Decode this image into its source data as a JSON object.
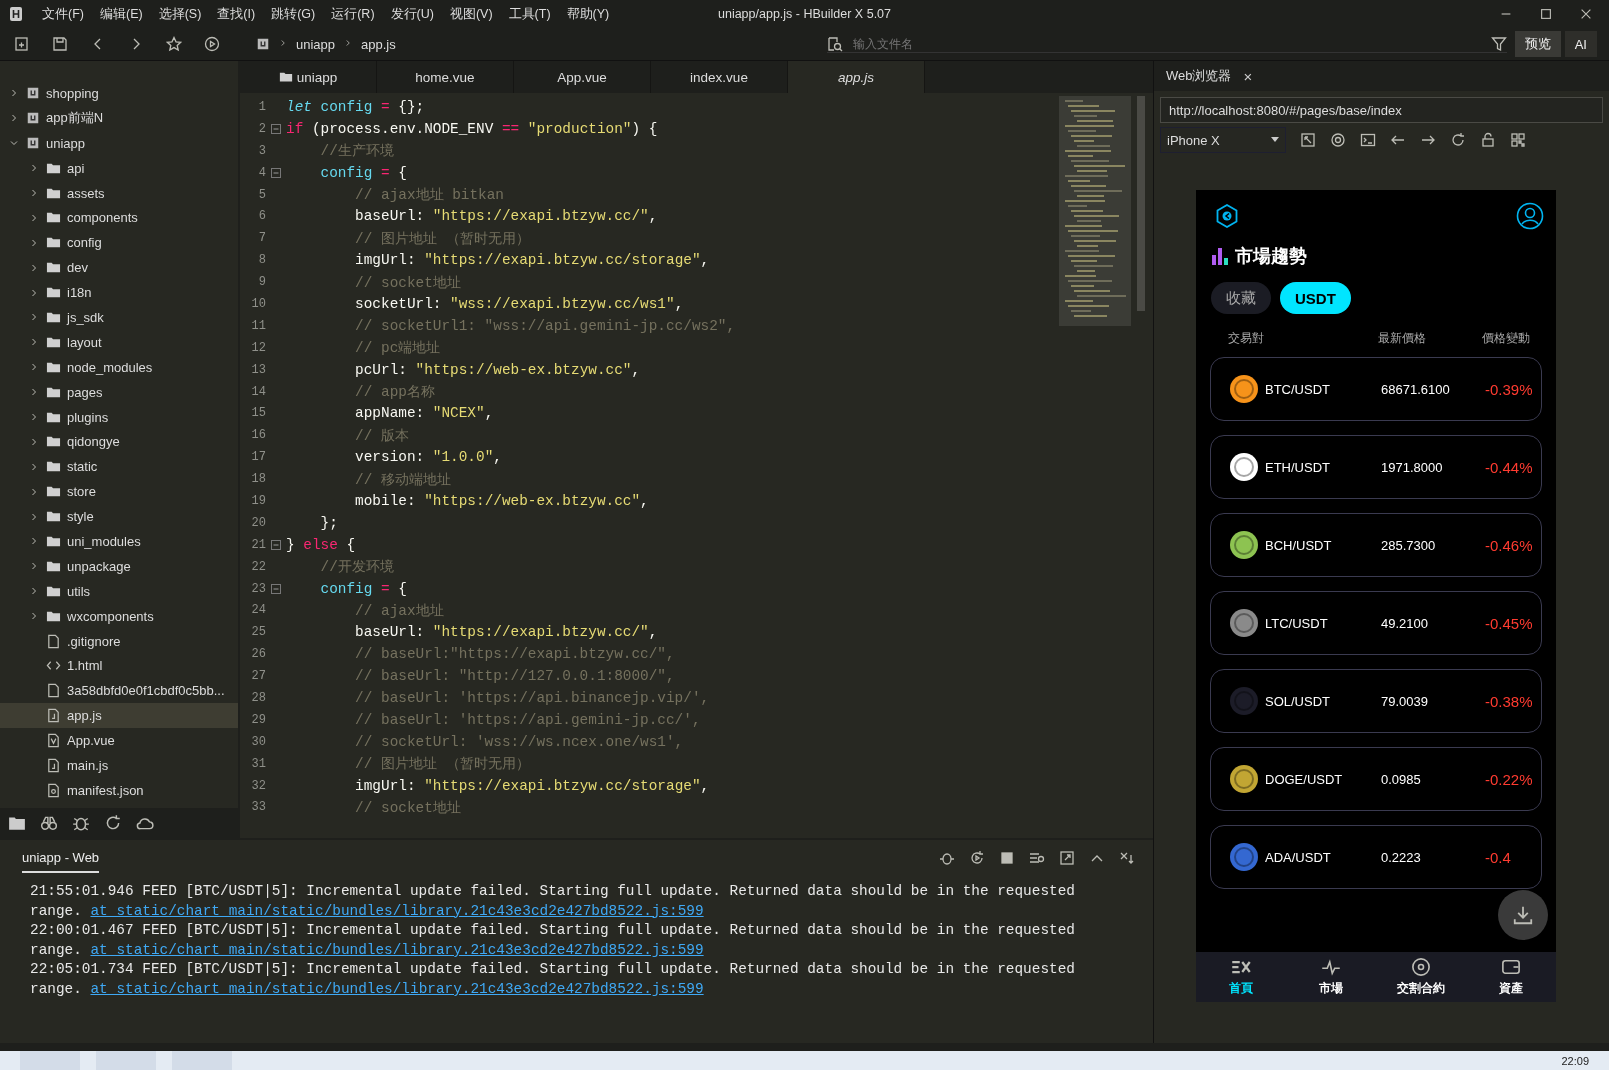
{
  "window": {
    "title": "uniapp/app.js - HBuilder X 5.07"
  },
  "menu": [
    "文件(F)",
    "编辑(E)",
    "选择(S)",
    "查找(I)",
    "跳转(G)",
    "运行(R)",
    "发行(U)",
    "视图(V)",
    "工具(T)",
    "帮助(Y)"
  ],
  "toolbar": {
    "breadcrumb": [
      "uniapp",
      "app.js"
    ],
    "search": {
      "placeholder": "输入文件名"
    },
    "buttons": [
      "预览",
      "AI"
    ]
  },
  "sidebar": {
    "tree": [
      {
        "name": "shopping",
        "kind": "project",
        "expanded": false,
        "selected": false
      },
      {
        "name": "app前端N",
        "kind": "project",
        "expanded": false,
        "selected": false
      },
      {
        "name": "uniapp",
        "kind": "project",
        "expanded": true,
        "selected": false,
        "children": [
          {
            "name": "api",
            "kind": "folder",
            "expanded": false,
            "selected": false
          },
          {
            "name": "assets",
            "kind": "folder",
            "expanded": false,
            "selected": false
          },
          {
            "name": "components",
            "kind": "folder",
            "expanded": false,
            "selected": false
          },
          {
            "name": "config",
            "kind": "folder",
            "expanded": false,
            "selected": false
          },
          {
            "name": "dev",
            "kind": "folder",
            "expanded": false,
            "selected": false
          },
          {
            "name": "i18n",
            "kind": "folder",
            "expanded": false,
            "selected": false
          },
          {
            "name": "js_sdk",
            "kind": "folder",
            "expanded": false,
            "selected": false
          },
          {
            "name": "layout",
            "kind": "folder",
            "expanded": false,
            "selected": false
          },
          {
            "name": "node_modules",
            "kind": "folder",
            "expanded": false,
            "selected": false
          },
          {
            "name": "pages",
            "kind": "folder",
            "expanded": false,
            "selected": false
          },
          {
            "name": "plugins",
            "kind": "folder",
            "expanded": false,
            "selected": false
          },
          {
            "name": "qidongye",
            "kind": "folder",
            "expanded": false,
            "selected": false
          },
          {
            "name": "static",
            "kind": "folder",
            "expanded": false,
            "selected": false
          },
          {
            "name": "store",
            "kind": "folder",
            "expanded": false,
            "selected": false
          },
          {
            "name": "style",
            "kind": "folder",
            "expanded": false,
            "selected": false
          },
          {
            "name": "uni_modules",
            "kind": "folder",
            "expanded": false,
            "selected": false
          },
          {
            "name": "unpackage",
            "kind": "folder",
            "expanded": false,
            "selected": false
          },
          {
            "name": "utils",
            "kind": "folder",
            "expanded": false,
            "selected": false
          },
          {
            "name": "wxcomponents",
            "kind": "folder",
            "expanded": false,
            "selected": false
          },
          {
            "name": ".gitignore",
            "kind": "file",
            "selected": false
          },
          {
            "name": "1.html",
            "kind": "html",
            "selected": false
          },
          {
            "name": "3a58dbfd0e0f1cbdf0c5bb...",
            "kind": "file",
            "selected": false
          },
          {
            "name": "app.js",
            "kind": "script",
            "selected": true
          },
          {
            "name": "App.vue",
            "kind": "vue",
            "selected": false
          },
          {
            "name": "main.js",
            "kind": "script",
            "selected": false
          },
          {
            "name": "manifest.json",
            "kind": "json",
            "selected": false
          }
        ]
      }
    ]
  },
  "editor": {
    "tabs": [
      {
        "label": "uniapp",
        "kind": "folder",
        "selected": false
      },
      {
        "label": "home.vue",
        "kind": "file",
        "selected": false
      },
      {
        "label": "App.vue",
        "kind": "file",
        "selected": false
      },
      {
        "label": "index.vue",
        "kind": "file",
        "selected": false
      },
      {
        "label": "app.js",
        "kind": "file",
        "selected": true
      }
    ],
    "lines": [
      {
        "number": "1",
        "fold": false,
        "tokens": [
          {
            "kind": "storage",
            "text": "let"
          },
          {
            "kind": "var",
            "text": " config"
          },
          {
            "kind": "op",
            "text": " ="
          },
          {
            "kind": "plain",
            "text": " {};"
          }
        ]
      },
      {
        "number": "2",
        "fold": true,
        "tokens": [
          {
            "kind": "kw",
            "text": "if"
          },
          {
            "kind": "plain",
            "text": " (process.env.NODE_ENV "
          },
          {
            "kind": "op",
            "text": "=="
          },
          {
            "kind": "str",
            "text": " \"production\""
          },
          {
            "kind": "plain",
            "text": ") {"
          }
        ]
      },
      {
        "number": "3",
        "fold": false,
        "tokens": [
          {
            "kind": "comment",
            "text": "    //生产环境"
          }
        ]
      },
      {
        "number": "4",
        "fold": true,
        "tokens": [
          {
            "kind": "var",
            "text": "    config"
          },
          {
            "kind": "op",
            "text": " ="
          },
          {
            "kind": "plain",
            "text": " {"
          }
        ]
      },
      {
        "number": "5",
        "fold": false,
        "tokens": [
          {
            "kind": "comment",
            "text": "        // ajax地址 bitkan"
          }
        ]
      },
      {
        "number": "6",
        "fold": false,
        "tokens": [
          {
            "kind": "plain",
            "text": "        baseUrl: "
          },
          {
            "kind": "str",
            "text": "\"https://exapi.btzyw.cc/\""
          },
          {
            "kind": "plain",
            "text": ","
          }
        ]
      },
      {
        "number": "7",
        "fold": false,
        "tokens": [
          {
            "kind": "comment",
            "text": "        // 图片地址 （暂时无用）"
          }
        ]
      },
      {
        "number": "8",
        "fold": false,
        "tokens": [
          {
            "kind": "plain",
            "text": "        imgUrl: "
          },
          {
            "kind": "str",
            "text": "\"https://exapi.btzyw.cc/storage\""
          },
          {
            "kind": "plain",
            "text": ","
          }
        ]
      },
      {
        "number": "9",
        "fold": false,
        "tokens": [
          {
            "kind": "comment",
            "text": "        // socket地址"
          }
        ]
      },
      {
        "number": "10",
        "fold": false,
        "tokens": [
          {
            "kind": "plain",
            "text": "        socketUrl: "
          },
          {
            "kind": "str",
            "text": "\"wss://exapi.btzyw.cc/ws1\""
          },
          {
            "kind": "plain",
            "text": ","
          }
        ]
      },
      {
        "number": "11",
        "fold": false,
        "tokens": [
          {
            "kind": "comment",
            "text": "        // socketUrl1: \"wss://api.gemini-jp.cc/ws2\","
          }
        ]
      },
      {
        "number": "12",
        "fold": false,
        "tokens": [
          {
            "kind": "comment",
            "text": "        // pc端地址"
          }
        ]
      },
      {
        "number": "13",
        "fold": false,
        "tokens": [
          {
            "kind": "plain",
            "text": "        pcUrl: "
          },
          {
            "kind": "str",
            "text": "\"https://web-ex.btzyw.cc\""
          },
          {
            "kind": "plain",
            "text": ","
          }
        ]
      },
      {
        "number": "14",
        "fold": false,
        "tokens": [
          {
            "kind": "comment",
            "text": "        // app名称"
          }
        ]
      },
      {
        "number": "15",
        "fold": false,
        "tokens": [
          {
            "kind": "plain",
            "text": "        appName: "
          },
          {
            "kind": "str",
            "text": "\"NCEX\""
          },
          {
            "kind": "plain",
            "text": ","
          }
        ]
      },
      {
        "number": "16",
        "fold": false,
        "tokens": [
          {
            "kind": "comment",
            "text": "        // 版本"
          }
        ]
      },
      {
        "number": "17",
        "fold": false,
        "tokens": [
          {
            "kind": "plain",
            "text": "        version: "
          },
          {
            "kind": "str",
            "text": "\"1.0.0\""
          },
          {
            "kind": "plain",
            "text": ","
          }
        ]
      },
      {
        "number": "18",
        "fold": false,
        "tokens": [
          {
            "kind": "comment",
            "text": "        // 移动端地址"
          }
        ]
      },
      {
        "number": "19",
        "fold": false,
        "tokens": [
          {
            "kind": "plain",
            "text": "        mobile: "
          },
          {
            "kind": "str",
            "text": "\"https://web-ex.btzyw.cc\""
          },
          {
            "kind": "plain",
            "text": ","
          }
        ]
      },
      {
        "number": "20",
        "fold": false,
        "tokens": [
          {
            "kind": "plain",
            "text": "    };"
          }
        ]
      },
      {
        "number": "21",
        "fold": true,
        "tokens": [
          {
            "kind": "plain",
            "text": "} "
          },
          {
            "kind": "kw",
            "text": "else"
          },
          {
            "kind": "plain",
            "text": " {"
          }
        ]
      },
      {
        "number": "22",
        "fold": false,
        "tokens": [
          {
            "kind": "comment",
            "text": "    //开发环境"
          }
        ]
      },
      {
        "number": "23",
        "fold": true,
        "tokens": [
          {
            "kind": "var",
            "text": "    config"
          },
          {
            "kind": "op",
            "text": " ="
          },
          {
            "kind": "plain",
            "text": " {"
          }
        ]
      },
      {
        "number": "24",
        "fold": false,
        "tokens": [
          {
            "kind": "comment",
            "text": "        // ajax地址"
          }
        ]
      },
      {
        "number": "25",
        "fold": false,
        "tokens": [
          {
            "kind": "plain",
            "text": "        baseUrl: "
          },
          {
            "kind": "str",
            "text": "\"https://exapi.btzyw.cc/\""
          },
          {
            "kind": "plain",
            "text": ","
          }
        ]
      },
      {
        "number": "26",
        "fold": false,
        "tokens": [
          {
            "kind": "comment",
            "text": "        // baseUrl:\"https://exapi.btzyw.cc/\","
          }
        ]
      },
      {
        "number": "27",
        "fold": false,
        "tokens": [
          {
            "kind": "comment",
            "text": "        // baseUrl: \"http://127.0.0.1:8000/\","
          }
        ]
      },
      {
        "number": "28",
        "fold": false,
        "tokens": [
          {
            "kind": "comment",
            "text": "        // baseUrl: 'https://api.binancejp.vip/',"
          }
        ]
      },
      {
        "number": "29",
        "fold": false,
        "tokens": [
          {
            "kind": "comment",
            "text": "        // baseUrl: 'https://api.gemini-jp.cc/',"
          }
        ]
      },
      {
        "number": "30",
        "fold": false,
        "tokens": [
          {
            "kind": "comment",
            "text": "        // socketUrl: 'wss://ws.ncex.one/ws1',"
          }
        ]
      },
      {
        "number": "31",
        "fold": false,
        "tokens": [
          {
            "kind": "comment",
            "text": "        // 图片地址 （暂时无用）"
          }
        ]
      },
      {
        "number": "32",
        "fold": false,
        "tokens": [
          {
            "kind": "plain",
            "text": "        imgUrl: "
          },
          {
            "kind": "str",
            "text": "\"https://exapi.btzyw.cc/storage\""
          },
          {
            "kind": "plain",
            "text": ","
          }
        ]
      },
      {
        "number": "33",
        "fold": false,
        "tokens": [
          {
            "kind": "comment",
            "text": "        // socket地址"
          }
        ]
      }
    ]
  },
  "console": {
    "tab": "uniapp - Web",
    "entries": [
      {
        "text": "21:55:01.946 FEED [BTC/USDT|5]: Incremental update failed. Starting full update. Returned data should be in the requested range.",
        "link": "at static/chart_main/static/bundles/library.21c43e3cd2e427bd8522.js:599"
      },
      {
        "text": "22:00:01.467 FEED [BTC/USDT|5]: Incremental update failed. Starting full update. Returned data should be in the requested range.",
        "link": "at static/chart_main/static/bundles/library.21c43e3cd2e427bd8522.js:599"
      },
      {
        "text": "22:05:01.734 FEED [BTC/USDT|5]: Incremental update failed. Starting full update. Returned data should be in the requested range.",
        "link": "at static/chart_main/static/bundles/library.21c43e3cd2e427bd8522.js:599"
      }
    ]
  },
  "browser": {
    "tab": "Web浏览器",
    "close": "×",
    "url": "http://localhost:8080/#/pages/base/index",
    "device": "iPhone X",
    "app": {
      "title": "市場趨勢",
      "tabs": [
        {
          "label": "收藏",
          "selected": false
        },
        {
          "label": "USDT",
          "selected": true
        }
      ],
      "columns": [
        "交易對",
        "最新價格",
        "價格變動"
      ],
      "rows": [
        {
          "pair": "BTC/USDT",
          "price": "68671.6100",
          "change": "-0.39%",
          "color": "#f7931a"
        },
        {
          "pair": "ETH/USDT",
          "price": "1971.8000",
          "change": "-0.44%",
          "color": "#ffffff"
        },
        {
          "pair": "BCH/USDT",
          "price": "285.7300",
          "change": "-0.46%",
          "color": "#8dc351"
        },
        {
          "pair": "LTC/USDT",
          "price": "49.2100",
          "change": "-0.45%",
          "color": "#8a8a8a"
        },
        {
          "pair": "SOL/USDT",
          "price": "79.0039",
          "change": "-0.38%",
          "color": "#1c1c28"
        },
        {
          "pair": "DOGE/USDT",
          "price": "0.0985",
          "change": "-0.22%",
          "color": "#c2a633"
        },
        {
          "pair": "ADA/USDT",
          "price": "0.2223",
          "change": "-0.4",
          "color": "#3468d1"
        }
      ],
      "nav": [
        {
          "label": "首頁",
          "kind": "home",
          "selected": true
        },
        {
          "label": "市場",
          "kind": "market",
          "selected": false
        },
        {
          "label": "交割合約",
          "kind": "contract",
          "selected": false
        },
        {
          "label": "資產",
          "kind": "assets",
          "selected": false
        }
      ]
    }
  },
  "taskbar": {
    "time": "22:09"
  }
}
